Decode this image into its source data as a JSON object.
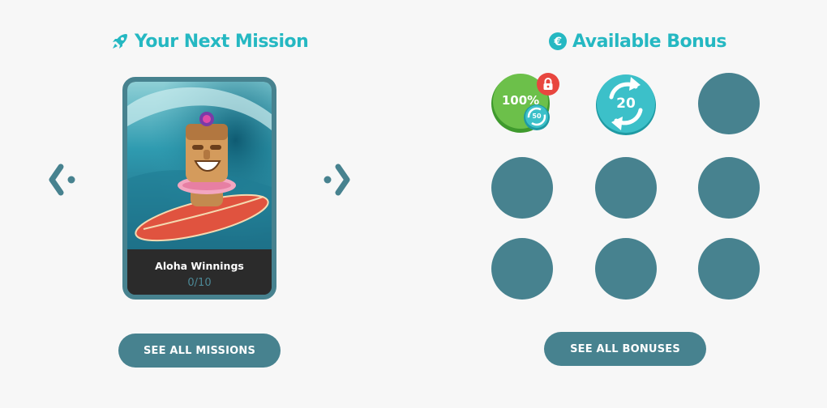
{
  "mission_section": {
    "title": "Your Next Mission",
    "icon": "rocket-icon",
    "card": {
      "title": "Aloha Winnings",
      "progress": "0/10"
    },
    "see_all_label": "SEE ALL MISSIONS"
  },
  "bonus_section": {
    "title": "Available Bonus",
    "icon": "euro-icon",
    "bonuses": [
      {
        "label": "100%",
        "sub_label": "50",
        "locked": true
      },
      {
        "label": "20"
      }
    ],
    "empty_slot_count": 7,
    "see_all_label": "SEE ALL BONUSES"
  },
  "colors": {
    "accent": "#25b8c2",
    "slate": "#47828f",
    "background": "#f7f7f7",
    "bonus_green": "#6cc04a",
    "lock_red": "#e8463f"
  }
}
